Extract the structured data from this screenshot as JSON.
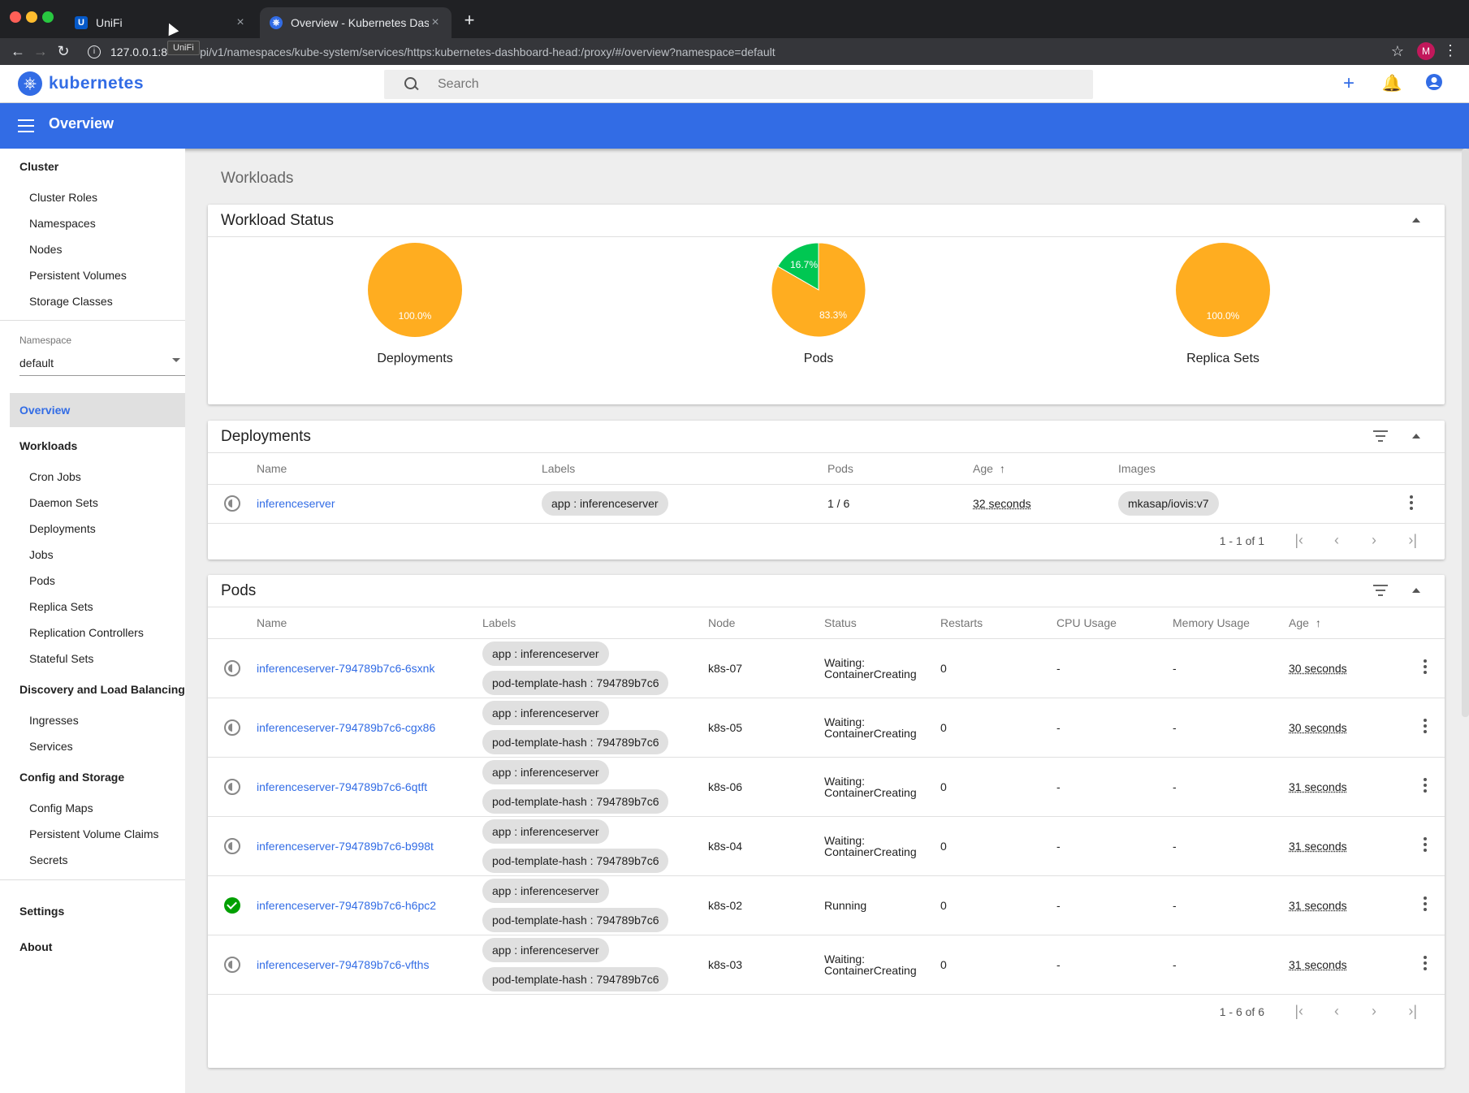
{
  "browser": {
    "tabs": [
      {
        "title": "UniFi",
        "active": false
      },
      {
        "title": "Overview - Kubernetes Dashbo",
        "active": true
      }
    ],
    "tooltip": "UniFi",
    "url_prefix": "127.0.0.1:8",
    "url_rest": "pi/v1/namespaces/kube-system/services/https:kubernetes-dashboard-head:/proxy/#/overview?namespace=default",
    "profile_initial": "M"
  },
  "app": {
    "logo_text": "kubernetes",
    "search_placeholder": "Search",
    "page_title": "Overview"
  },
  "sidebar": {
    "cluster_title": "Cluster",
    "cluster_items": [
      "Cluster Roles",
      "Namespaces",
      "Nodes",
      "Persistent Volumes",
      "Storage Classes"
    ],
    "namespace_label": "Namespace",
    "namespace_value": "default",
    "overview": "Overview",
    "workloads_title": "Workloads",
    "workloads_items": [
      "Cron Jobs",
      "Daemon Sets",
      "Deployments",
      "Jobs",
      "Pods",
      "Replica Sets",
      "Replication Controllers",
      "Stateful Sets"
    ],
    "discovery_title": "Discovery and Load Balancing",
    "discovery_items": [
      "Ingresses",
      "Services"
    ],
    "config_title": "Config and Storage",
    "config_items": [
      "Config Maps",
      "Persistent Volume Claims",
      "Secrets"
    ],
    "settings": "Settings",
    "about": "About"
  },
  "main": {
    "section_title": "Workloads",
    "workload_status": {
      "title": "Workload Status",
      "charts": [
        {
          "label": "Deployments",
          "slices": [
            {
              "value": 100.0,
              "text": "100.0%",
              "color": "#ffad20"
            }
          ]
        },
        {
          "label": "Pods",
          "slices": [
            {
              "value": 83.3,
              "text": "83.3%",
              "color": "#ffad20"
            },
            {
              "value": 16.7,
              "text": "16.7%",
              "color": "#00c752"
            }
          ]
        },
        {
          "label": "Replica Sets",
          "slices": [
            {
              "value": 100.0,
              "text": "100.0%",
              "color": "#ffad20"
            }
          ]
        }
      ]
    },
    "deployments": {
      "title": "Deployments",
      "columns": [
        "Name",
        "Labels",
        "Pods",
        "Age",
        "Images"
      ],
      "rows": [
        {
          "name": "inferenceserver",
          "label": "app : inferenceserver",
          "pods": "1 / 6",
          "age": "32 seconds",
          "image": "mkasap/iovis:v7",
          "status": "pending"
        }
      ],
      "pager": "1 - 1 of 1"
    },
    "pods": {
      "title": "Pods",
      "columns": [
        "Name",
        "Labels",
        "Node",
        "Status",
        "Restarts",
        "CPU Usage",
        "Memory Usage",
        "Age"
      ],
      "rows": [
        {
          "name": "inferenceserver-794789b7c6-6sxnk",
          "labels": [
            "app : inferenceserver",
            "pod-template-hash : 794789b7c6"
          ],
          "node": "k8s-07",
          "status": [
            "Waiting:",
            "ContainerCreating"
          ],
          "restarts": "0",
          "cpu": "-",
          "mem": "-",
          "age": "30 seconds",
          "state": "pending"
        },
        {
          "name": "inferenceserver-794789b7c6-cgx86",
          "labels": [
            "app : inferenceserver",
            "pod-template-hash : 794789b7c6"
          ],
          "node": "k8s-05",
          "status": [
            "Waiting:",
            "ContainerCreating"
          ],
          "restarts": "0",
          "cpu": "-",
          "mem": "-",
          "age": "30 seconds",
          "state": "pending"
        },
        {
          "name": "inferenceserver-794789b7c6-6qtft",
          "labels": [
            "app : inferenceserver",
            "pod-template-hash : 794789b7c6"
          ],
          "node": "k8s-06",
          "status": [
            "Waiting:",
            "ContainerCreating"
          ],
          "restarts": "0",
          "cpu": "-",
          "mem": "-",
          "age": "31 seconds",
          "state": "pending"
        },
        {
          "name": "inferenceserver-794789b7c6-b998t",
          "labels": [
            "app : inferenceserver",
            "pod-template-hash : 794789b7c6"
          ],
          "node": "k8s-04",
          "status": [
            "Waiting:",
            "ContainerCreating"
          ],
          "restarts": "0",
          "cpu": "-",
          "mem": "-",
          "age": "31 seconds",
          "state": "pending"
        },
        {
          "name": "inferenceserver-794789b7c6-h6pc2",
          "labels": [
            "app : inferenceserver",
            "pod-template-hash : 794789b7c6"
          ],
          "node": "k8s-02",
          "status": [
            "Running"
          ],
          "restarts": "0",
          "cpu": "-",
          "mem": "-",
          "age": "31 seconds",
          "state": "ok"
        },
        {
          "name": "inferenceserver-794789b7c6-vfths",
          "labels": [
            "app : inferenceserver",
            "pod-template-hash : 794789b7c6"
          ],
          "node": "k8s-03",
          "status": [
            "Waiting:",
            "ContainerCreating"
          ],
          "restarts": "0",
          "cpu": "-",
          "mem": "-",
          "age": "31 seconds",
          "state": "pending"
        }
      ],
      "pager": "1 - 6 of 6"
    }
  },
  "colors": {
    "accent": "#326ce5",
    "pending_chart": "#ffad20",
    "running_chart": "#00c752",
    "running_icon": "#00a000"
  }
}
